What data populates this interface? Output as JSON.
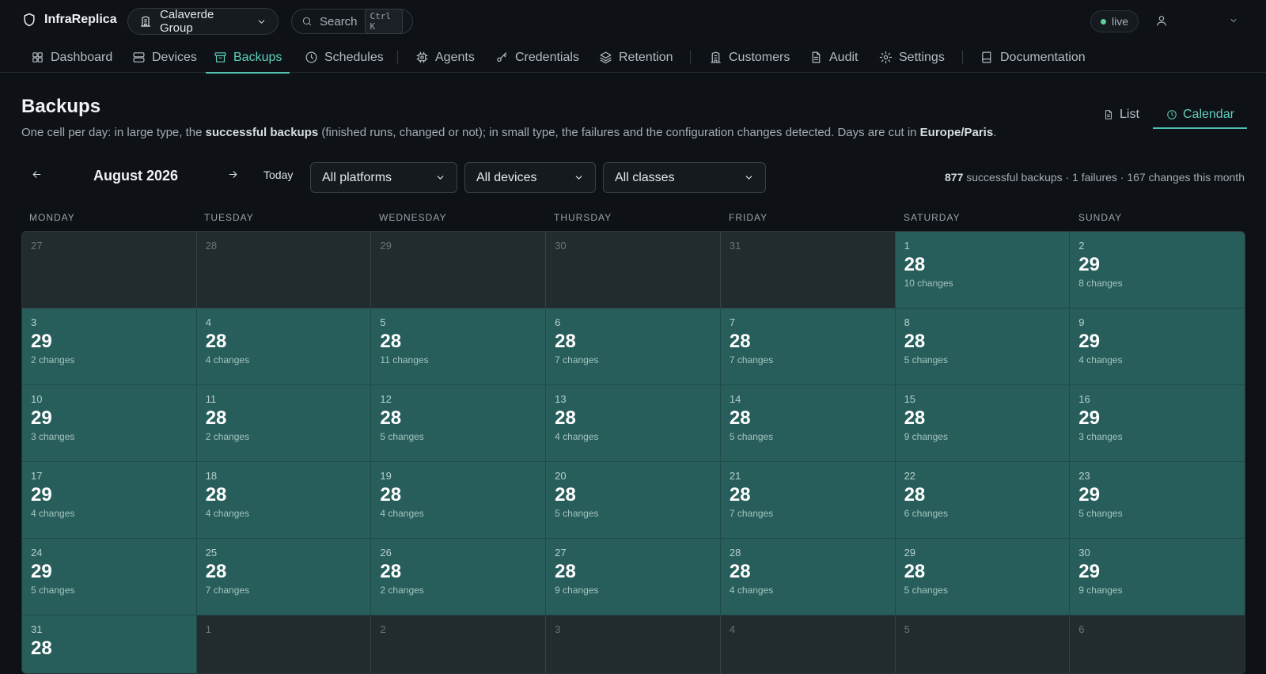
{
  "app": {
    "name": "InfraReplica",
    "org": "Calaverde Group",
    "search_label": "Search",
    "search_shortcut": "Ctrl K",
    "status": "live"
  },
  "nav": {
    "items": [
      {
        "label": "Dashboard",
        "icon": "dashboard-icon"
      },
      {
        "label": "Devices",
        "icon": "server-icon"
      },
      {
        "label": "Backups",
        "icon": "archive-icon",
        "active": true
      },
      {
        "label": "Schedules",
        "icon": "clock-icon"
      },
      {
        "label": "Agents",
        "icon": "cpu-icon"
      },
      {
        "label": "Credentials",
        "icon": "key-icon"
      },
      {
        "label": "Retention",
        "icon": "layers-icon"
      },
      {
        "label": "Customers",
        "icon": "building-icon"
      },
      {
        "label": "Audit",
        "icon": "file-text-icon"
      },
      {
        "label": "Settings",
        "icon": "gear-icon"
      },
      {
        "label": "Documentation",
        "icon": "book-icon"
      }
    ]
  },
  "page": {
    "title": "Backups",
    "desc_1": "One cell per day: in large type, the ",
    "desc_b1": "successful backups",
    "desc_2": " (finished runs, changed or not); in small type, the failures and the configuration changes detected. Days are cut in ",
    "desc_b2": "Europe/Paris",
    "desc_3": ".",
    "view_list": "List",
    "view_calendar": "Calendar"
  },
  "toolbar": {
    "month": "August 2026",
    "today": "Today",
    "platform_filter": "All platforms",
    "device_filter": "All devices",
    "class_filter": "All classes",
    "stats_successful": "877",
    "stats_rest": " successful backups · 1 failures · 167 changes this month"
  },
  "colors": {
    "accent": "#4fc3b0",
    "cell_in_month": "#275e5b",
    "cell_out_month": "#222b2e"
  },
  "calendar": {
    "weekdays": [
      "MONDAY",
      "TUESDAY",
      "WEDNESDAY",
      "THURSDAY",
      "FRIDAY",
      "SATURDAY",
      "SUNDAY"
    ],
    "cells": [
      {
        "day": "27",
        "in": false
      },
      {
        "day": "28",
        "in": false
      },
      {
        "day": "29",
        "in": false
      },
      {
        "day": "30",
        "in": false
      },
      {
        "day": "31",
        "in": false
      },
      {
        "day": "1",
        "in": true,
        "count": "28",
        "changes": "10 changes"
      },
      {
        "day": "2",
        "in": true,
        "count": "29",
        "changes": "8 changes"
      },
      {
        "day": "3",
        "in": true,
        "count": "29",
        "changes": "2 changes"
      },
      {
        "day": "4",
        "in": true,
        "count": "28",
        "changes": "4 changes"
      },
      {
        "day": "5",
        "in": true,
        "count": "28",
        "changes": "11 changes"
      },
      {
        "day": "6",
        "in": true,
        "count": "28",
        "changes": "7 changes"
      },
      {
        "day": "7",
        "in": true,
        "count": "28",
        "changes": "7 changes"
      },
      {
        "day": "8",
        "in": true,
        "count": "28",
        "changes": "5 changes"
      },
      {
        "day": "9",
        "in": true,
        "count": "29",
        "changes": "4 changes"
      },
      {
        "day": "10",
        "in": true,
        "count": "29",
        "changes": "3 changes"
      },
      {
        "day": "11",
        "in": true,
        "count": "28",
        "changes": "2 changes"
      },
      {
        "day": "12",
        "in": true,
        "count": "28",
        "changes": "5 changes"
      },
      {
        "day": "13",
        "in": true,
        "count": "28",
        "changes": "4 changes"
      },
      {
        "day": "14",
        "in": true,
        "count": "28",
        "changes": "5 changes"
      },
      {
        "day": "15",
        "in": true,
        "count": "28",
        "changes": "9 changes"
      },
      {
        "day": "16",
        "in": true,
        "count": "29",
        "changes": "3 changes"
      },
      {
        "day": "17",
        "in": true,
        "count": "29",
        "changes": "4 changes"
      },
      {
        "day": "18",
        "in": true,
        "count": "28",
        "changes": "4 changes"
      },
      {
        "day": "19",
        "in": true,
        "count": "28",
        "changes": "4 changes"
      },
      {
        "day": "20",
        "in": true,
        "count": "28",
        "changes": "5 changes"
      },
      {
        "day": "21",
        "in": true,
        "count": "28",
        "changes": "7 changes"
      },
      {
        "day": "22",
        "in": true,
        "count": "28",
        "changes": "6 changes"
      },
      {
        "day": "23",
        "in": true,
        "count": "29",
        "changes": "5 changes"
      },
      {
        "day": "24",
        "in": true,
        "count": "29",
        "changes": "5 changes"
      },
      {
        "day": "25",
        "in": true,
        "count": "28",
        "changes": "7 changes"
      },
      {
        "day": "26",
        "in": true,
        "count": "28",
        "changes": "2 changes"
      },
      {
        "day": "27",
        "in": true,
        "count": "28",
        "changes": "9 changes"
      },
      {
        "day": "28",
        "in": true,
        "count": "28",
        "changes": "4 changes"
      },
      {
        "day": "29",
        "in": true,
        "count": "28",
        "changes": "5 changes"
      },
      {
        "day": "30",
        "in": true,
        "count": "29",
        "changes": "9 changes"
      },
      {
        "day": "31",
        "in": true,
        "count": "28",
        "changes": ""
      },
      {
        "day": "1",
        "in": false
      },
      {
        "day": "2",
        "in": false
      },
      {
        "day": "3",
        "in": false
      },
      {
        "day": "4",
        "in": false
      },
      {
        "day": "5",
        "in": false
      },
      {
        "day": "6",
        "in": false
      }
    ]
  }
}
